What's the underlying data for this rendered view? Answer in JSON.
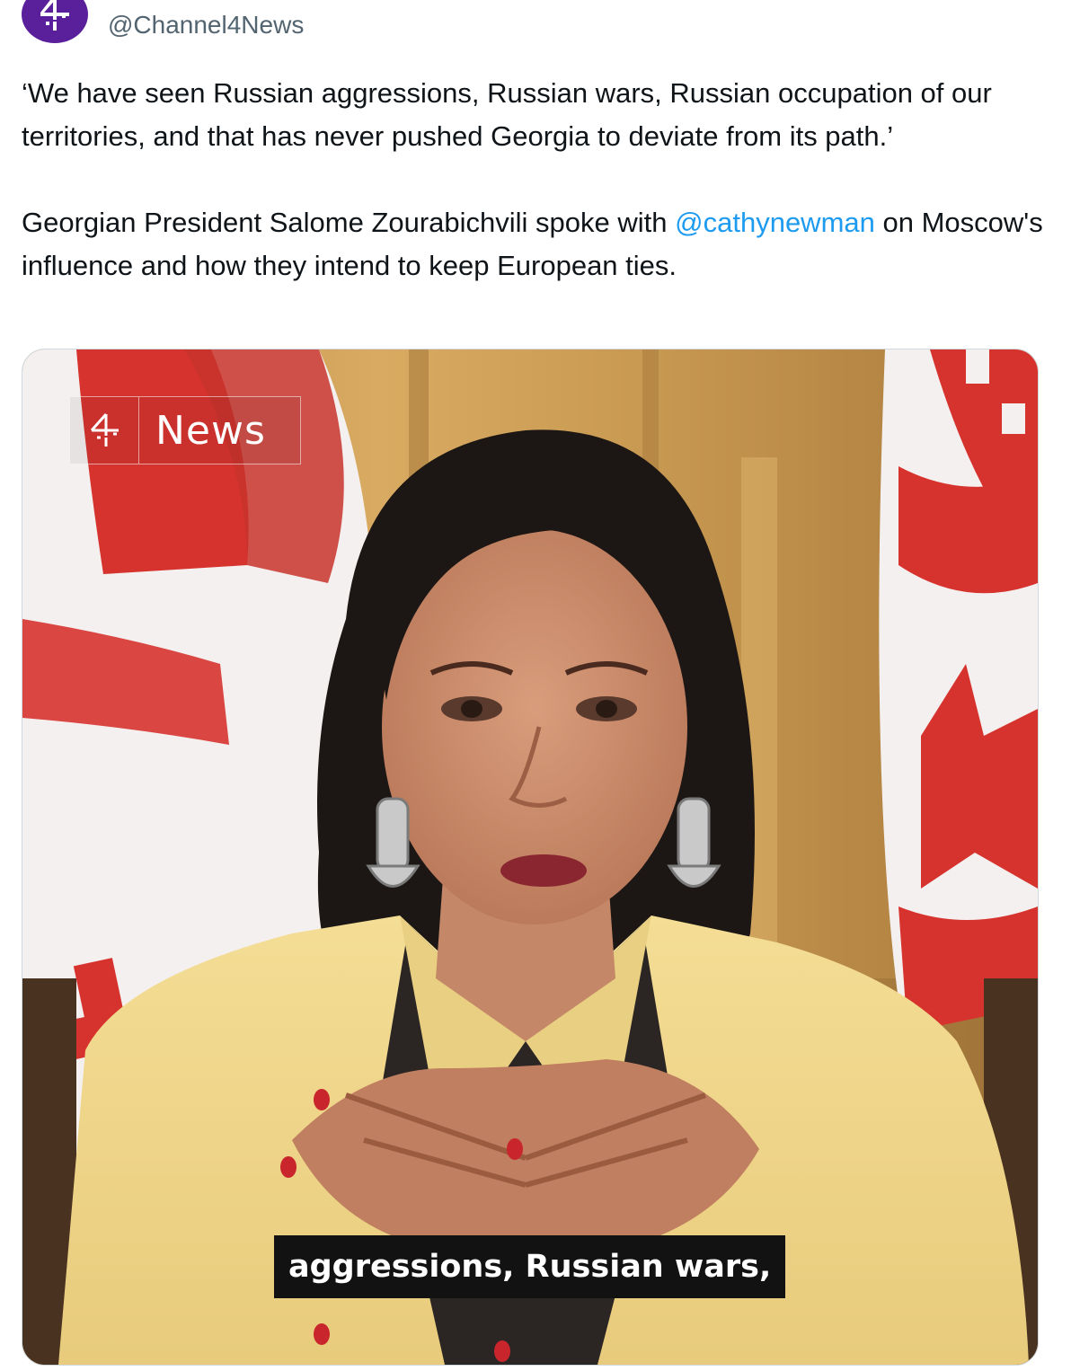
{
  "tweet": {
    "handle": "@Channel4News",
    "quote": "‘We have seen Russian aggressions, Russian wars, Russian occupation of our territories, and that has never pushed Georgia to deviate from its path.’",
    "body_before_mention": "Georgian President Salome Zourabichvili spoke with ",
    "mention": "@cathynewman",
    "body_after_mention": " on Moscow's influence and how they intend to keep European ties."
  },
  "media": {
    "logo_word": "News",
    "subtitle": "aggressions, Russian wars,"
  },
  "icons": {
    "avatar": "channel4-logo-icon",
    "verified": "verified-badge-icon",
    "video_logo": "channel4-logo-icon"
  },
  "colors": {
    "avatar_bg": "#5a1f9a",
    "mention": "#1d9bf0",
    "text": "#0f1419",
    "handle": "#536471",
    "flag_red": "#d7332e",
    "jacket": "#f1d98e"
  }
}
